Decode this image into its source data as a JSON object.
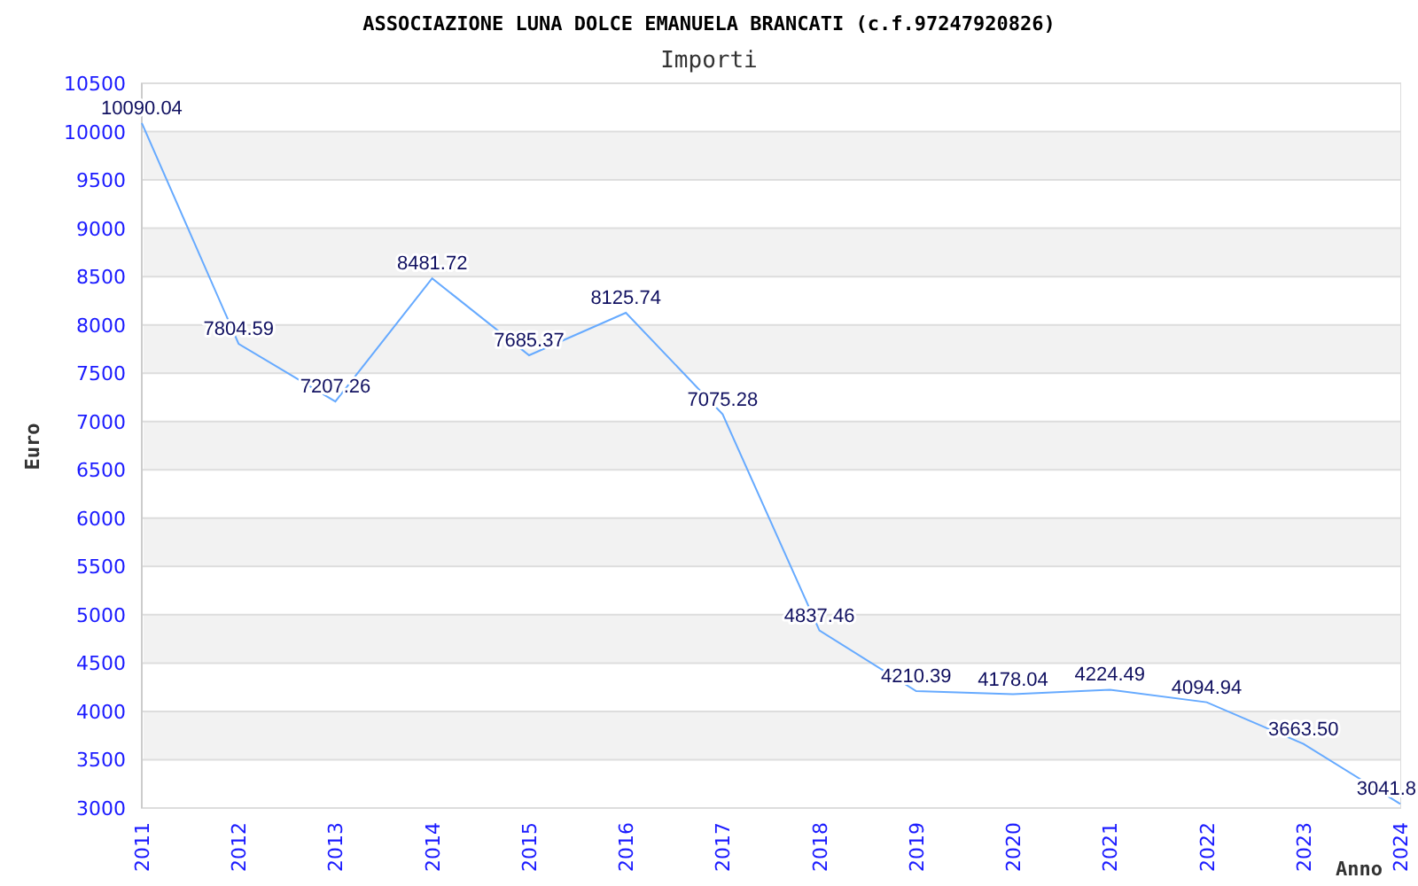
{
  "title": "ASSOCIAZIONE LUNA DOLCE EMANUELA BRANCATI (c.f.97247920826)",
  "chart_data": {
    "type": "line",
    "grid": true,
    "xlabel": "Anno",
    "ylabel": "Euro",
    "categories": [
      "2011",
      "2012",
      "2013",
      "2014",
      "2015",
      "2016",
      "2017",
      "2018",
      "2019",
      "2020",
      "2021",
      "2022",
      "2023",
      "2024"
    ],
    "series": [
      {
        "name": "Importi",
        "color": "#66aaff",
        "values": [
          10090.04,
          7804.59,
          7207.26,
          8481.72,
          7685.37,
          8125.74,
          7075.28,
          4837.46,
          4210.39,
          4178.04,
          4224.49,
          4094.94,
          3663.5,
          3041.8
        ]
      }
    ],
    "ylim": [
      3000,
      10500
    ],
    "yticks": [
      3000,
      3500,
      4000,
      4500,
      5000,
      5500,
      6000,
      6500,
      7000,
      7500,
      8000,
      8500,
      9000,
      9500,
      10000,
      10500
    ],
    "value_labels": [
      "10090.04",
      "7804.59",
      "7207.26",
      "8481.72",
      "7685.37",
      "8125.74",
      "7075.28",
      "4837.46",
      "4210.39",
      "4178.04",
      "4224.49",
      "4094.94",
      "3663.50",
      "3041.8"
    ]
  }
}
